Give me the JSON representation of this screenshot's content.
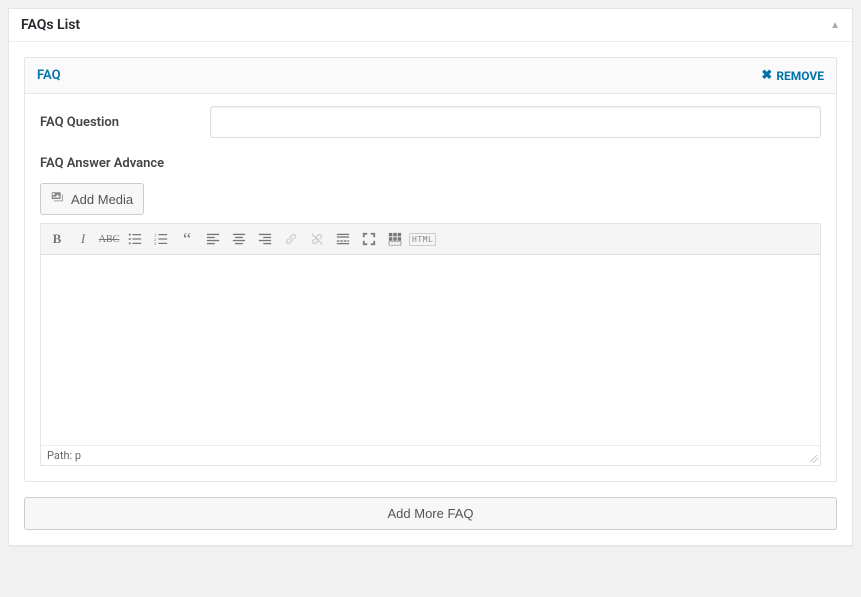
{
  "metabox": {
    "title": "FAQs List"
  },
  "faq": {
    "header_title": "FAQ",
    "remove_label": "REMOVE",
    "question_label": "FAQ Question",
    "question_value": "",
    "answer_label": "FAQ Answer Advance"
  },
  "add_media": {
    "label": "Add Media"
  },
  "editor": {
    "status": "Path: p",
    "html_label": "HTML"
  },
  "add_more": {
    "label": "Add More FAQ"
  }
}
